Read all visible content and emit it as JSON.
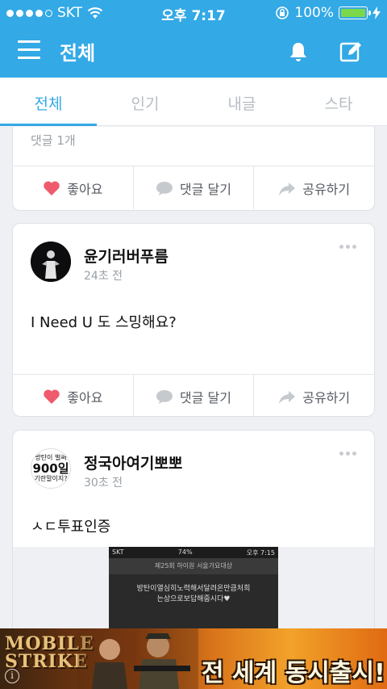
{
  "status_bar": {
    "carrier": "SKT",
    "time": "오후 7:17",
    "battery": "100%"
  },
  "header": {
    "title": "전체"
  },
  "tabs": [
    {
      "label": "전체",
      "active": true
    },
    {
      "label": "인기",
      "active": false
    },
    {
      "label": "내글",
      "active": false
    },
    {
      "label": "스타",
      "active": false
    }
  ],
  "actions": {
    "like": "좋아요",
    "comment": "댓글 달기",
    "share": "공유하기"
  },
  "feed": {
    "prev_card": {
      "comment_count": "댓글 1개"
    },
    "posts": [
      {
        "author": "윤기러버푸름",
        "time": "24초 전",
        "text": "I Need U 도 스밍해요?"
      },
      {
        "author": "정국아여기뽀뽀",
        "time": "30초 전",
        "text": "ㅅㄷ투표인증",
        "avatar_text": [
          "방탄이 벌써",
          "900일",
          "기란말이지?"
        ],
        "image": {
          "status_carrier": "SKT",
          "status_battery": "74%",
          "status_time": "오후 7:15",
          "header": "제25회 하이원 서울가요대상",
          "body": [
            "방탄이열심히노력해서달려온만큼처희",
            "는상으로보답해줍시다♥"
          ]
        }
      }
    ]
  },
  "ad": {
    "brand_lines": [
      "MOBILE",
      "STRIKE"
    ],
    "headline": "전 세계 동시출시!",
    "info_label": "i"
  },
  "colors": {
    "primary": "#33a9e6",
    "heart": "#ee5b6e",
    "battery": "#7bd84b"
  }
}
